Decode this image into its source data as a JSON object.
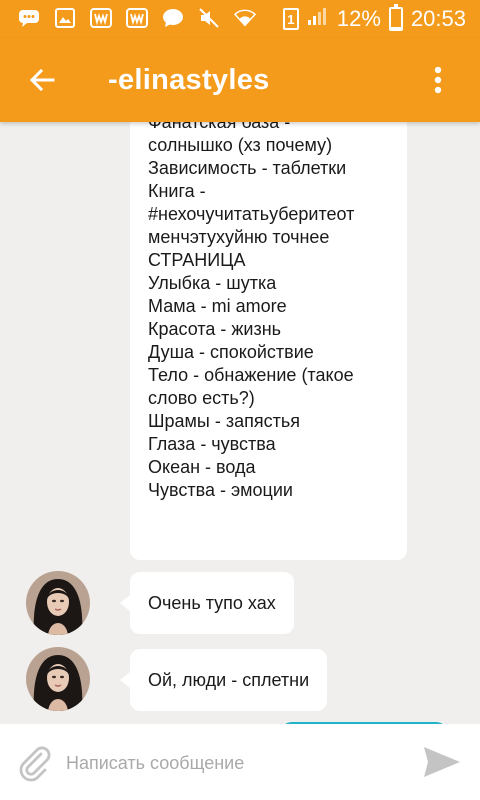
{
  "status_bar": {
    "battery": "12%",
    "time": "20:53",
    "sim": "1",
    "icons": [
      "chat-bubble-icon",
      "image-icon",
      "w-app-icon",
      "w-app-icon",
      "message-icon",
      "mute-icon",
      "wifi-icon",
      "sim-icon",
      "signal-icon",
      "battery-charging-icon"
    ]
  },
  "header": {
    "title": "-elinastyles",
    "back_icon": "arrow-left-icon",
    "menu_icon": "more-vertical-icon"
  },
  "chat": {
    "long_message_lines": [
      "Фанатская база -",
      "солнышко (хз почему)",
      "Зависимость - таблетки",
      "Книга -",
      "#нехочучитатьуберитеот",
      "менчэтухуйню точнее",
      "СТРАНИЦА",
      "Улыбка - шутка",
      "Мама - mi amore",
      "Красота - жизнь",
      "Душа - спокойствие",
      "Тело - обнажение (такое",
      "слово есть?)",
      "Шрамы - запястья",
      "Глаза - чувства",
      "Океан - вода",
      "Чувства - эмоции"
    ],
    "messages": [
      {
        "text": "Очень тупо хах"
      },
      {
        "text": "Ой, люди - сплетни"
      }
    ]
  },
  "input": {
    "placeholder": "Написать сообщение"
  },
  "colors": {
    "accent": "#f49b1c",
    "outgoing_bubble": "#21b4c8",
    "chat_background": "#f0efed"
  }
}
